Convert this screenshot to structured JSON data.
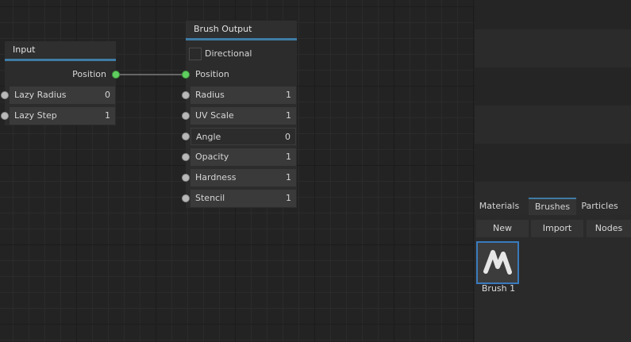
{
  "input_node": {
    "title": "Input",
    "output_label": "Position",
    "fields": [
      {
        "label": "Lazy Radius",
        "value": "0"
      },
      {
        "label": "Lazy Step",
        "value": "1"
      }
    ]
  },
  "brush_output_node": {
    "title": "Brush Output",
    "checkbox_label": "Directional",
    "input_label": "Position",
    "fields": [
      {
        "label": "Radius",
        "value": "1"
      },
      {
        "label": "UV Scale",
        "value": "1"
      },
      {
        "label": "Angle",
        "value": "0"
      },
      {
        "label": "Opacity",
        "value": "1"
      },
      {
        "label": "Hardness",
        "value": "1"
      },
      {
        "label": "Stencil",
        "value": "1"
      }
    ]
  },
  "right_panel": {
    "tabs": [
      {
        "label": "Materials"
      },
      {
        "label": "Brushes"
      },
      {
        "label": "Particles"
      }
    ],
    "active_tab": "Brushes",
    "toolbar": {
      "new": "New",
      "import": "Import",
      "nodes": "Nodes"
    },
    "assets": [
      {
        "name": "Brush 1",
        "icon": "brush-stroke-icon"
      }
    ]
  },
  "colors": {
    "accent": "#3f7ca5",
    "connected_port": "#5fce5f",
    "selection": "#3a7bbd"
  }
}
